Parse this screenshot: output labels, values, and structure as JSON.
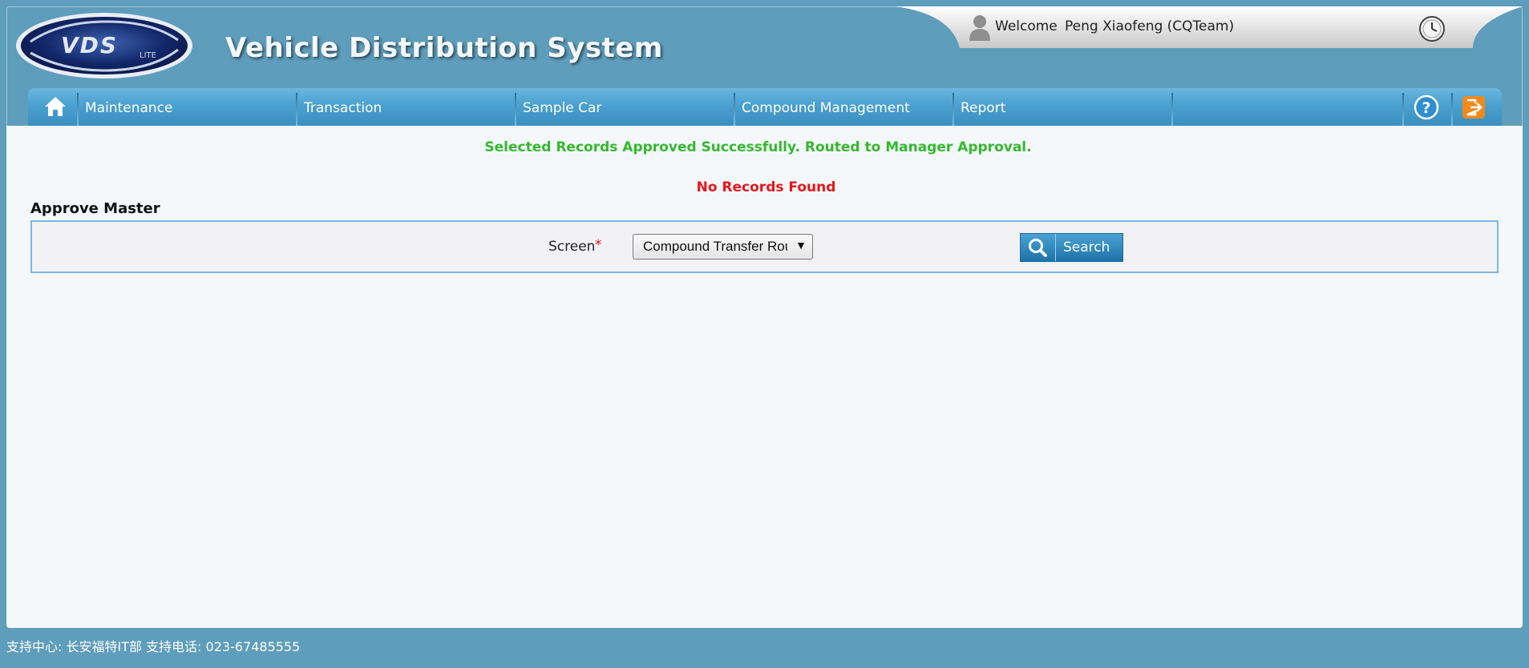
{
  "header": {
    "logo_text": "VDS LITE",
    "app_title": "Vehicle Distribution System",
    "welcome_label": "Welcome",
    "user_name": "Peng Xiaofeng (CQTeam)"
  },
  "nav": {
    "items": [
      {
        "label": "Maintenance"
      },
      {
        "label": "Transaction"
      },
      {
        "label": "Sample Car"
      },
      {
        "label": "Compound Management"
      },
      {
        "label": "Report"
      }
    ]
  },
  "messages": {
    "success": "Selected Records Approved Successfully. Routed to Manager Approval.",
    "no_records": "No Records Found"
  },
  "section": {
    "title": "Approve Master"
  },
  "filter": {
    "screen_label": "Screen",
    "required_mark": "*",
    "screen_value": "Compound Transfer Rou",
    "search_label": "Search"
  },
  "footer": {
    "text": "支持中心: 长安福特IT部 支持电话: 023-67485555"
  },
  "colors": {
    "background": "#5e9dbb",
    "nav": "#4aa0cf",
    "success": "#35b82f",
    "error": "#e8161c"
  }
}
